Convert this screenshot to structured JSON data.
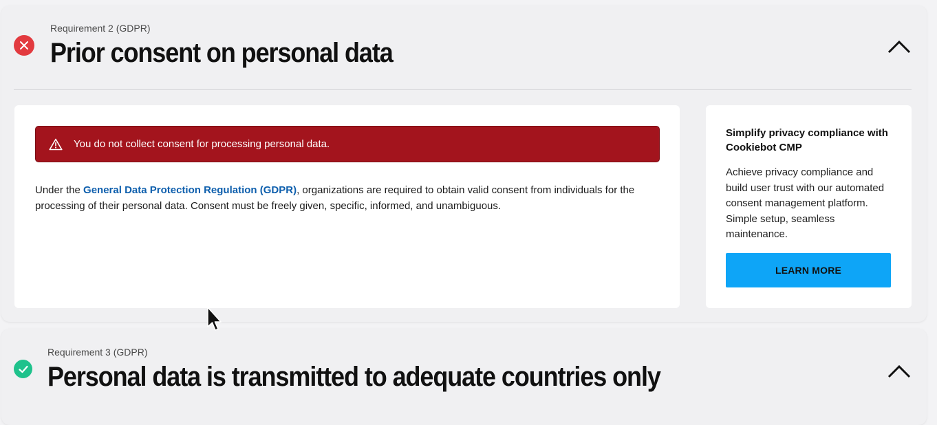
{
  "requirements": [
    {
      "label": "Requirement 2 (GDPR)",
      "title": "Prior consent on personal data",
      "status": "fail",
      "status_color": "#e23a3f",
      "status_icon": "close-icon",
      "toggle_icon": "chevron-up-icon",
      "alert": "You do not collect consent for processing personal data.",
      "alert_icon": "warning-icon",
      "description": {
        "prefix": "Under the ",
        "link": "General Data Protection Regulation (GDPR)",
        "suffix": ", organizations are required to obtain valid consent from individuals for the processing of their personal data. Consent must be freely given, specific, informed, and unambiguous."
      }
    },
    {
      "label": "Requirement 3 (GDPR)",
      "title": "Personal data is transmitted to adequate countries only",
      "status": "pass",
      "status_color": "#1fc28c",
      "status_icon": "check-icon",
      "toggle_icon": "chevron-up-icon"
    }
  ],
  "promo": {
    "title": "Simplify privacy compliance with Cookiebot CMP",
    "body": "Achieve privacy compliance and build user trust with our automated consent management platform. Simple setup, seamless maintenance.",
    "button": "LEARN MORE",
    "button_color": "#0ea5f7"
  },
  "colors": {
    "alert_bg": "#a3141d",
    "link": "#0e5fad"
  }
}
